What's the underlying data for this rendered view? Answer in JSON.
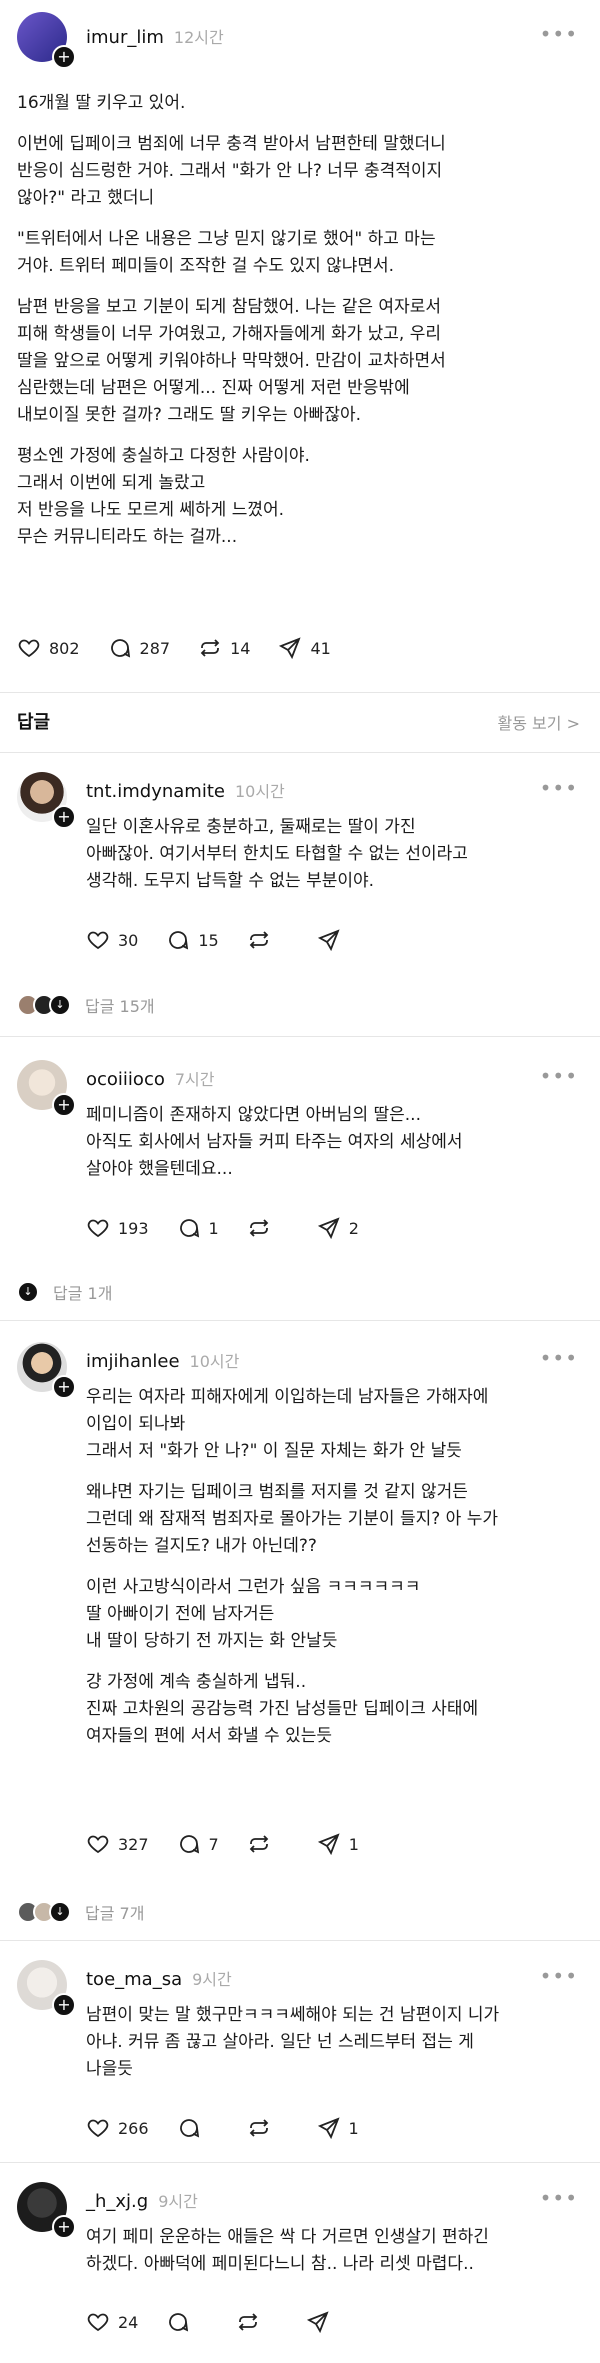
{
  "main_post": {
    "username": "imur_lim",
    "time": "12시간",
    "paragraphs": [
      "16개월 딸 키우고 있어.",
      "이번에 딥페이크 범죄에 너무 충격 받아서 남편한테 말했더니\n반응이 심드렁한 거야. 그래서 \"화가 안 나? 너무 충격적이지\n않아?\" 라고 했더니",
      "\"트위터에서 나온 내용은 그냥 믿지 않기로 했어\" 하고 마는\n거야. 트위터 페미들이 조작한 걸 수도 있지 않냐면서.",
      "남편 반응을 보고 기분이 되게 참담했어. 나는 같은 여자로서\n피해 학생들이 너무 가여웠고, 가해자들에게 화가 났고, 우리\n딸을 앞으로 어떻게 키워야하나 막막했어. 만감이 교차하면서\n심란했는데 남편은 어떻게... 진짜 어떻게 저런 반응밖에\n내보이질 못한 걸까? 그래도 딸 키우는 아빠잖아.",
      "평소엔 가정에 충실하고 다정한 사람이야.\n그래서 이번에 되게 놀랐고\n저 반응을 나도 모르게 쎄하게 느꼈어.\n무슨 커뮤니티라도 하는 걸까..."
    ],
    "likes": "802",
    "comments": "287",
    "reposts": "14",
    "shares": "41"
  },
  "replies_header": {
    "title": "답글",
    "activity_label": "활동 보기",
    "activity_chevron": ">"
  },
  "replies": [
    {
      "username": "tnt.imdynamite",
      "time": "10시간",
      "paragraphs": [
        "일단 이혼사유로 충분하고, 둘째로는 딸이 가진\n아빠잖아. 여기서부터 한치도 타협할 수 없는 선이라고\n생각해. 도무지 납득할 수 없는 부분이야."
      ],
      "likes": "30",
      "comments": "15",
      "reposts": "",
      "shares": "",
      "reply_count": "답글 15개"
    },
    {
      "username": "ocoiiioco",
      "time": "7시간",
      "paragraphs": [
        "페미니즘이 존재하지 않았다면 아버님의 딸은...\n아직도 회사에서 남자들 커피 타주는 여자의 세상에서\n살아야 했을텐데요..."
      ],
      "likes": "193",
      "comments": "1",
      "reposts": "",
      "shares": "2",
      "reply_count": "답글 1개"
    },
    {
      "username": "imjihanlee",
      "time": "10시간",
      "paragraphs": [
        "우리는 여자라 피해자에게 이입하는데 남자들은 가해자에\n이입이 되나봐\n그래서 저 \"화가 안 나?\" 이 질문 자체는 화가 안 날듯",
        "왜냐면 자기는 딥페이크 범죄를 저지를 것 같지 않거든\n그런데 왜 잠재적 범죄자로 몰아가는 기분이 들지? 아 누가\n선동하는 걸지도? 내가 아닌데??",
        "이런 사고방식이라서 그런가 싶음 ㅋㅋㅋㅋㅋㅋ\n딸 아빠이기 전에 남자거든\n내 딸이 당하기 전 까지는 화 안날듯",
        "걍 가정에 계속 충실하게 냅둬..\n진짜 고차원의 공감능력 가진 남성들만 딥페이크 사태에\n여자들의 편에 서서 화낼 수 있는듯"
      ],
      "likes": "327",
      "comments": "7",
      "reposts": "",
      "shares": "1",
      "reply_count": "답글 7개"
    },
    {
      "username": "toe_ma_sa",
      "time": "9시간",
      "paragraphs": [
        "남편이 맞는 말 했구만ㅋㅋㅋ쎄해야 되는 건 남편이지 니가\n아냐. 커뮤 좀 끊고 살아라. 일단 넌 스레드부터 접는 게\n나을듯"
      ],
      "likes": "266",
      "comments": "",
      "reposts": "",
      "shares": "1",
      "reply_count": ""
    },
    {
      "username": "_h_xj.g",
      "time": "9시간",
      "paragraphs": [
        "여기 페미 운운하는 애들은 싹 다 거르면 인생살기 편하긴\n하겠다. 아빠덕에 페미된다느니 참.. 나라 리셋 마렵다.."
      ],
      "likes": "24",
      "comments": "",
      "reposts": "",
      "shares": "",
      "reply_count": ""
    }
  ],
  "colors": {
    "text": "#1a1a1a",
    "muted": "#999999",
    "divider": "#e6e6e6"
  },
  "icons": [
    "heart-icon",
    "comment-icon",
    "repost-icon",
    "share-icon",
    "more-icon",
    "follow-plus-icon"
  ]
}
